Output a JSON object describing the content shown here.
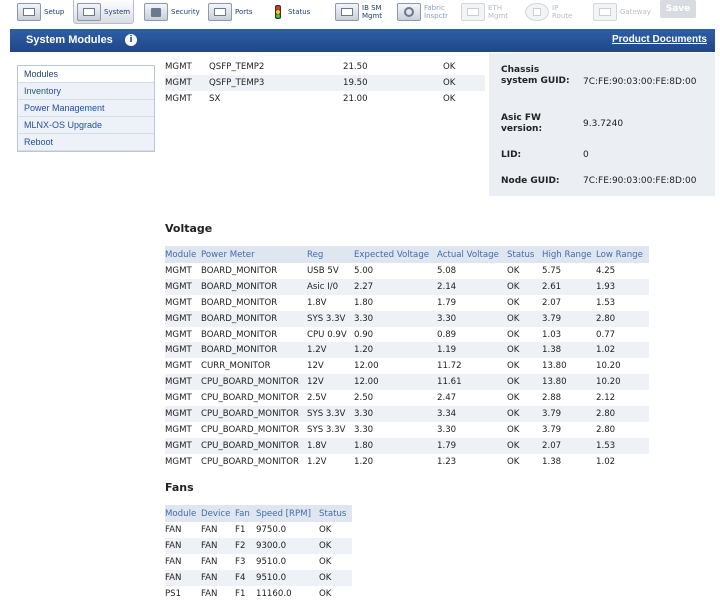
{
  "toolbar": {
    "items": [
      {
        "label": "Setup",
        "icon": "setup-icon"
      },
      {
        "label": "System",
        "icon": "system-icon"
      },
      {
        "label": "Security",
        "icon": "lock-icon"
      },
      {
        "label": "Ports",
        "icon": "ports-icon"
      },
      {
        "label": "Status",
        "icon": "traffic-light-icon"
      },
      {
        "label": "IB SM Mgmt",
        "icon": "ib-sm-icon"
      },
      {
        "label": "Fabric Inspctr",
        "icon": "magnifier-icon"
      },
      {
        "label": "ETH Mgmt",
        "icon": "eth-icon"
      },
      {
        "label": "IP Route",
        "icon": "ip-route-icon"
      },
      {
        "label": "Gateway",
        "icon": "gateway-icon"
      }
    ],
    "save_label": "Save"
  },
  "header": {
    "title": "System Modules",
    "product_docs": "Product Documents"
  },
  "sidebar": {
    "items": [
      {
        "label": "Modules"
      },
      {
        "label": "Inventory"
      },
      {
        "label": "Power Management"
      },
      {
        "label": "MLNX-OS Upgrade"
      },
      {
        "label": "Reboot"
      }
    ]
  },
  "temperature": {
    "rows": [
      [
        "MGMT",
        "QSFP_TEMP2",
        "21.50",
        "OK"
      ],
      [
        "MGMT",
        "QSFP_TEMP3",
        "19.50",
        "OK"
      ],
      [
        "MGMT",
        "SX",
        "21.00",
        "OK"
      ]
    ]
  },
  "info_panel": {
    "chassis_guid_label": "Chassis system GUID:",
    "chassis_guid_value": "7C:FE:90:03:00:FE:8D:00",
    "asic_fw_label": "Asic FW version:",
    "asic_fw_value": "9.3.7240",
    "lid_label": "LID:",
    "lid_value": "0",
    "node_guid_label": "Node GUID:",
    "node_guid_value": "7C:FE:90:03:00:FE:8D:00"
  },
  "voltage": {
    "title": "Voltage",
    "headers": [
      "Module",
      "Power Meter",
      "Reg",
      "Expected Voltage",
      "Actual Voltage",
      "Status",
      "High Range",
      "Low Range"
    ],
    "rows": [
      [
        "MGMT",
        "BOARD_MONITOR",
        "USB 5V",
        "5.00",
        "5.08",
        "OK",
        "5.75",
        "4.25"
      ],
      [
        "MGMT",
        "BOARD_MONITOR",
        "Asic I/0",
        "2.27",
        "2.14",
        "OK",
        "2.61",
        "1.93"
      ],
      [
        "MGMT",
        "BOARD_MONITOR",
        "1.8V",
        "1.80",
        "1.79",
        "OK",
        "2.07",
        "1.53"
      ],
      [
        "MGMT",
        "BOARD_MONITOR",
        "SYS 3.3V",
        "3.30",
        "3.30",
        "OK",
        "3.79",
        "2.80"
      ],
      [
        "MGMT",
        "BOARD_MONITOR",
        "CPU 0.9V",
        "0.90",
        "0.89",
        "OK",
        "1.03",
        "0.77"
      ],
      [
        "MGMT",
        "BOARD_MONITOR",
        "1.2V",
        "1.20",
        "1.19",
        "OK",
        "1.38",
        "1.02"
      ],
      [
        "MGMT",
        "CURR_MONITOR",
        "12V",
        "12.00",
        "11.72",
        "OK",
        "13.80",
        "10.20"
      ],
      [
        "MGMT",
        "CPU_BOARD_MONITOR",
        "12V",
        "12.00",
        "11.61",
        "OK",
        "13.80",
        "10.20"
      ],
      [
        "MGMT",
        "CPU_BOARD_MONITOR",
        "2.5V",
        "2.50",
        "2.47",
        "OK",
        "2.88",
        "2.12"
      ],
      [
        "MGMT",
        "CPU_BOARD_MONITOR",
        "SYS 3.3V",
        "3.30",
        "3.34",
        "OK",
        "3.79",
        "2.80"
      ],
      [
        "MGMT",
        "CPU_BOARD_MONITOR",
        "SYS 3.3V",
        "3.30",
        "3.30",
        "OK",
        "3.79",
        "2.80"
      ],
      [
        "MGMT",
        "CPU_BOARD_MONITOR",
        "1.8V",
        "1.80",
        "1.79",
        "OK",
        "2.07",
        "1.53"
      ],
      [
        "MGMT",
        "CPU_BOARD_MONITOR",
        "1.2V",
        "1.20",
        "1.23",
        "OK",
        "1.38",
        "1.02"
      ]
    ]
  },
  "fans": {
    "title": "Fans",
    "headers": [
      "Module",
      "Device",
      "Fan",
      "Speed [RPM]",
      "Status"
    ],
    "rows": [
      [
        "FAN",
        "FAN",
        "F1",
        "9750.0",
        "OK"
      ],
      [
        "FAN",
        "FAN",
        "F2",
        "9300.0",
        "OK"
      ],
      [
        "FAN",
        "FAN",
        "F3",
        "9510.0",
        "OK"
      ],
      [
        "FAN",
        "FAN",
        "F4",
        "9510.0",
        "OK"
      ],
      [
        "PS1",
        "FAN",
        "F1",
        "11160.0",
        "OK"
      ]
    ]
  }
}
